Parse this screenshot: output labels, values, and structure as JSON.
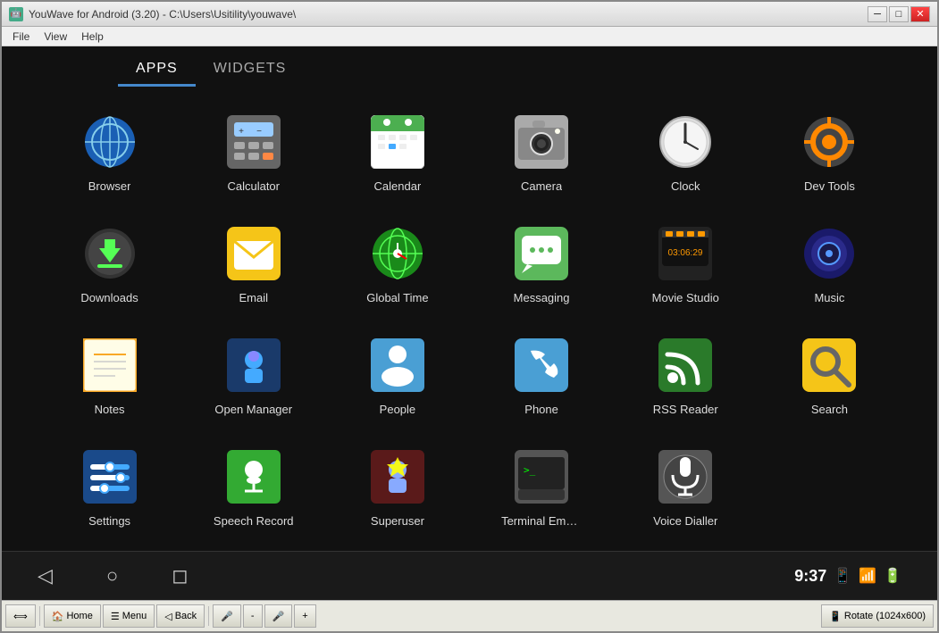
{
  "window": {
    "title": "YouWave for Android (3.20) - C:\\Users\\Usitility\\youwave\\",
    "icon": "🤖"
  },
  "menu": {
    "items": [
      "File",
      "View",
      "Help"
    ]
  },
  "tabs": [
    {
      "label": "APPS",
      "active": true
    },
    {
      "label": "WIDGETS",
      "active": false
    }
  ],
  "apps": [
    {
      "name": "Browser",
      "icon": "🌐",
      "iconClass": "icon-browser"
    },
    {
      "name": "Calculator",
      "icon": "🔢",
      "iconClass": "icon-calculator"
    },
    {
      "name": "Calendar",
      "icon": "📅",
      "iconClass": "icon-calendar"
    },
    {
      "name": "Camera",
      "icon": "📷",
      "iconClass": "icon-camera"
    },
    {
      "name": "Clock",
      "icon": "🕐",
      "iconClass": "icon-clock"
    },
    {
      "name": "Dev Tools",
      "icon": "⚙️",
      "iconClass": "icon-devtools"
    },
    {
      "name": "Downloads",
      "icon": "⬇️",
      "iconClass": "icon-downloads"
    },
    {
      "name": "Email",
      "icon": "✉️",
      "iconClass": "icon-email"
    },
    {
      "name": "Global Time",
      "icon": "🌍",
      "iconClass": "icon-globaltime"
    },
    {
      "name": "Messaging",
      "icon": "💬",
      "iconClass": "icon-messaging"
    },
    {
      "name": "Movie Studio",
      "icon": "🎬",
      "iconClass": "icon-moviestudio"
    },
    {
      "name": "Music",
      "icon": "🎵",
      "iconClass": "icon-music"
    },
    {
      "name": "Notes",
      "icon": "📝",
      "iconClass": "icon-notes"
    },
    {
      "name": "Open Manager",
      "icon": "🤖",
      "iconClass": "icon-openmanager"
    },
    {
      "name": "People",
      "icon": "👤",
      "iconClass": "icon-people"
    },
    {
      "name": "Phone",
      "icon": "📞",
      "iconClass": "icon-phone"
    },
    {
      "name": "RSS Reader",
      "icon": "🤖",
      "iconClass": "icon-rss"
    },
    {
      "name": "Search",
      "icon": "🔍",
      "iconClass": "icon-search"
    },
    {
      "name": "Settings",
      "icon": "⚙️",
      "iconClass": "icon-settings"
    },
    {
      "name": "Speech Record",
      "icon": "🤖",
      "iconClass": "icon-speechrecord"
    },
    {
      "name": "Superuser",
      "icon": "🤖",
      "iconClass": "icon-superuser"
    },
    {
      "name": "Terminal Emula...",
      "icon": "💻",
      "iconClass": "icon-terminal"
    },
    {
      "name": "Voice Dialler",
      "icon": "🎙️",
      "iconClass": "icon-voicedialler"
    }
  ],
  "status": {
    "time": "9:37"
  },
  "taskbar": {
    "back_icon": "◁",
    "home_label": "Home",
    "menu_label": "Menu",
    "back_label": "Back",
    "mic_minus": "-",
    "mic_plus": "+",
    "rotate_label": "Rotate (1024x600)"
  }
}
